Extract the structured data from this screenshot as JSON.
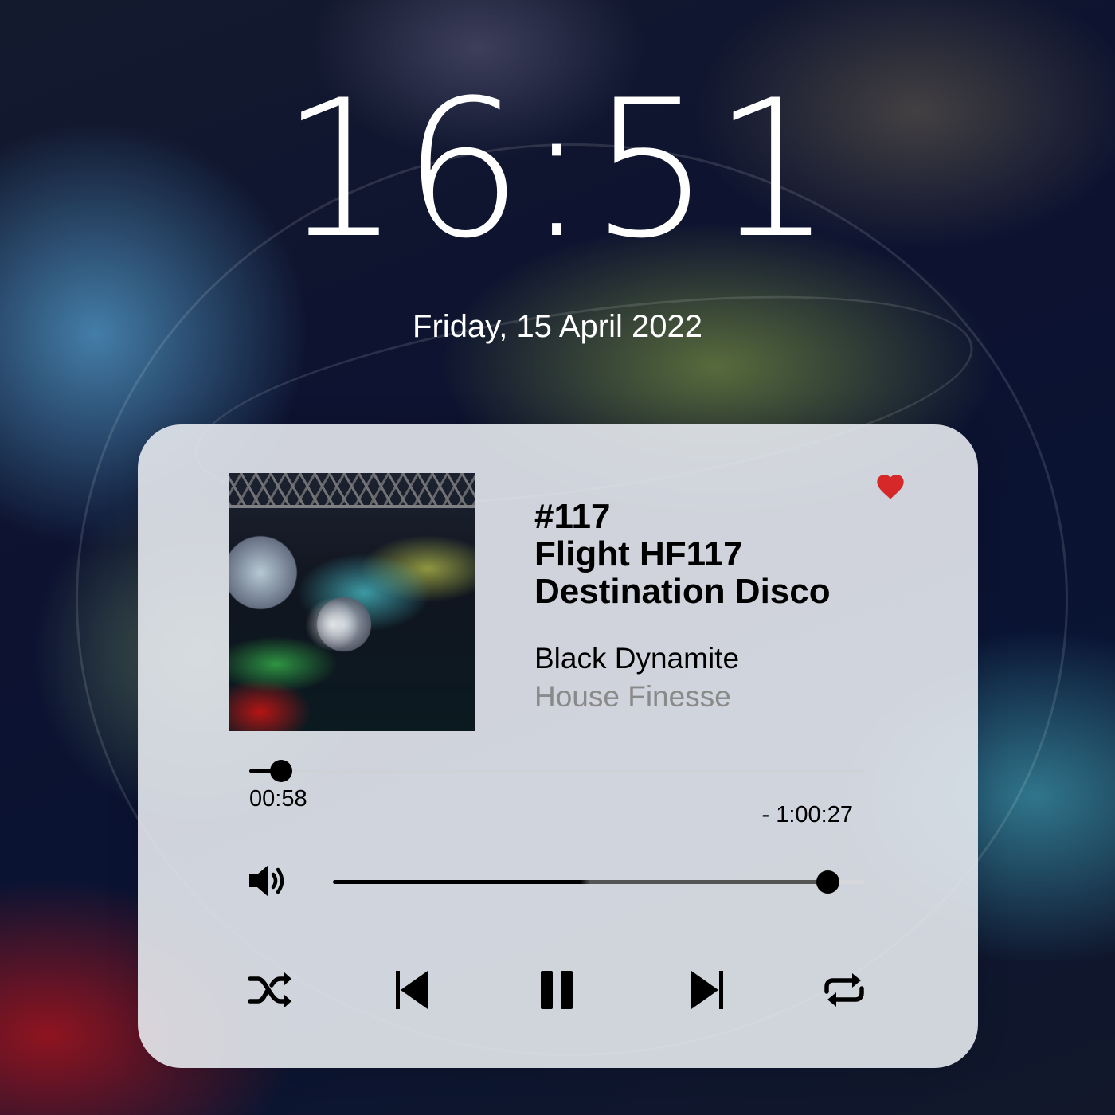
{
  "lockscreen": {
    "time": "16:51",
    "date": "Friday, 15 April 2022"
  },
  "player": {
    "title_lines": [
      "#117",
      "Flight HF117",
      "Destination Disco"
    ],
    "artist": "Black Dynamite",
    "label": "House Finesse",
    "elapsed": "00:58",
    "remaining": "- 1:00:27",
    "progress_fraction": 0.052,
    "volume_fraction": 0.93,
    "favorite": true,
    "colors": {
      "heart": "#d62828",
      "text": "#000000",
      "secondary_text": "#8a8a8a",
      "card_bg": "#e6e9ee"
    },
    "icons": {
      "favorite": "heart-icon",
      "volume": "speaker-volume-icon",
      "shuffle": "shuffle-icon",
      "previous": "skip-previous-icon",
      "pause": "pause-icon",
      "next": "skip-next-icon",
      "repeat": "repeat-icon"
    }
  }
}
